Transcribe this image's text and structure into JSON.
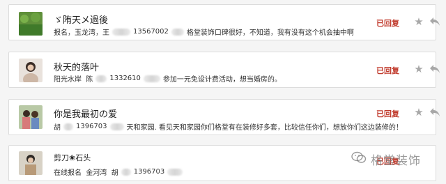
{
  "messages": [
    {
      "name": "ゞ陏天メ過後",
      "message_parts": [
        "报名，玉龙湾，王",
        "13567002",
        "格堂装饰口碑很好，不知道，我有没有这个机会抽中啊"
      ],
      "status": "已回复",
      "avatar_icon": "avatar-green-field"
    },
    {
      "name": "秋天的落叶",
      "message_parts": [
        "阳光水岸  陈",
        "1332610",
        "参加一元免设计费活动，想当婚房的。"
      ],
      "status": "已回复",
      "avatar_icon": "avatar-girl-photo"
    },
    {
      "name": "你是我最初の爱",
      "message_parts": [
        "胡",
        "1396703",
        "天和家园. 看见天和家园你们格堂有在装修好多套，比较信任你们，想放你们这边装修的！"
      ],
      "status": "已回复",
      "avatar_icon": "avatar-couple-photo"
    },
    {
      "name": "剪刀❀石头",
      "message_parts": [
        "在线报名  金河湾  胡",
        "1396703"
      ],
      "status": "已回复",
      "avatar_icon": "avatar-child-photo"
    }
  ],
  "watermark": {
    "text": "格堂装饰",
    "icon": "wechat-icon"
  },
  "colors": {
    "status": "#c0392b",
    "icon": "#a8a8a8"
  }
}
